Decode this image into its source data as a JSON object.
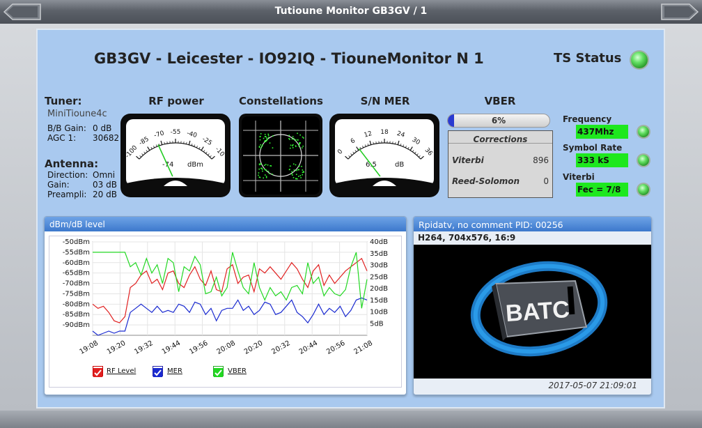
{
  "window": {
    "title": "Tutioune Monitor GB3GV / 1"
  },
  "header": {
    "station_title": "GB3GV - Leicester - IO92IQ - TiouneMonitor N 1",
    "ts_status_label": "TS Status"
  },
  "tuner": {
    "heading": "Tuner:",
    "model": "MiniTioune4c",
    "bb_gain_label": "B/B Gain:",
    "bb_gain_value": "0 dB",
    "agc_label": "AGC 1:",
    "agc_value": "30682 U"
  },
  "antenna": {
    "heading": "Antenna:",
    "direction_label": "Direction:",
    "direction_value": "Omni",
    "gain_label": "Gain:",
    "gain_value": "03 dB",
    "preampli_label": "Preampli:",
    "preampli_value": "20 dB"
  },
  "rf_power": {
    "title": "RF power",
    "reading": "-74",
    "unit": "dBm",
    "scale": [
      "-100",
      "-85",
      "-70",
      "-55",
      "-40",
      "-25",
      "-10"
    ],
    "min": -100,
    "max": -10,
    "value": -74
  },
  "constellations": {
    "title": "Constellations"
  },
  "mer": {
    "title": "S/N MER",
    "reading": "6.5",
    "unit": "dB",
    "scale": [
      "0",
      "6",
      "12",
      "18",
      "24",
      "30",
      "36"
    ],
    "min": 0,
    "max": 36,
    "value": 6.5
  },
  "vber": {
    "title": "VBER",
    "percent_text": "6%",
    "percent": 6,
    "corrections_title": "Corrections",
    "viterbi_label": "Viterbi",
    "viterbi_value": "896",
    "rs_label": "Reed-Solomon",
    "rs_value": "0"
  },
  "status": {
    "frequency_label": "Frequency",
    "frequency_value": "437Mhz",
    "symbol_rate_label": "Symbol Rate",
    "symbol_rate_value": "333 kS",
    "viterbi_label": "Viterbi",
    "viterbi_value": "Fec = 7/8"
  },
  "level_chart": {
    "header": "dBm/dB level",
    "legend": [
      "RF Level",
      "MER",
      "VBER"
    ]
  },
  "chart_data": {
    "type": "line",
    "title": "dBm/dB level",
    "x": [
      "19:08",
      "19:20",
      "19:32",
      "19:44",
      "19:56",
      "20:08",
      "20:20",
      "20:32",
      "20:44",
      "20:56",
      "21:08"
    ],
    "y_left_ticks": [
      "-50dBm",
      "-55dBm",
      "-60dBm",
      "-65dBm",
      "-70dBm",
      "-75dBm",
      "-80dBm",
      "-85dBm",
      "-90dBm"
    ],
    "y_right_ticks": [
      "40dB",
      "35dB",
      "30dB",
      "25dB",
      "20dB",
      "15dB",
      "10dB",
      "5dB"
    ],
    "ylim_left": [
      -95,
      -50
    ],
    "ylim_right": [
      0,
      40
    ],
    "grid": true,
    "series": [
      {
        "name": "RF Level",
        "color": "#e02020",
        "axis": "left",
        "values": [
          -80,
          -82,
          -81,
          -84,
          -88,
          -89,
          -86,
          -72,
          -70,
          -66,
          -64,
          -70,
          -68,
          -73,
          -65,
          -64,
          -70,
          -72,
          -66,
          -62,
          -68,
          -71,
          -64,
          -73,
          -74,
          -63,
          -61,
          -70,
          -67,
          -66,
          -74,
          -63,
          -65,
          -62,
          -65,
          -68,
          -64,
          -60,
          -63,
          -68,
          -72,
          -64,
          -61,
          -71,
          -66,
          -70,
          -67,
          -64,
          -62,
          -60,
          -58,
          -64
        ]
      },
      {
        "name": "MER",
        "color": "#1a2ad0",
        "axis": "left",
        "values": [
          -93,
          -95,
          -94,
          -93,
          -94,
          -93,
          -93,
          -84,
          -82,
          -80,
          -82,
          -84,
          -81,
          -84,
          -83,
          -84,
          -80,
          -81,
          -84,
          -79,
          -80,
          -85,
          -82,
          -88,
          -83,
          -82,
          -82,
          -78,
          -83,
          -81,
          -85,
          -83,
          -79,
          -80,
          -85,
          -84,
          -81,
          -78,
          -84,
          -86,
          -89,
          -85,
          -80,
          -85,
          -82,
          -84,
          -81,
          -86,
          -83,
          -78,
          -77,
          -78
        ]
      },
      {
        "name": "VBER",
        "color": "#22d822",
        "axis": "left",
        "values": [
          -55,
          -55,
          -55,
          -55,
          -55,
          -55,
          -55,
          -62,
          -60,
          -66,
          -58,
          -65,
          -61,
          -70,
          -58,
          -60,
          -74,
          -62,
          -64,
          -57,
          -61,
          -75,
          -74,
          -67,
          -76,
          -72,
          -55,
          -64,
          -72,
          -75,
          -60,
          -72,
          -78,
          -72,
          -76,
          -74,
          -78,
          -72,
          -71,
          -75,
          -60,
          -70,
          -67,
          -76,
          -72,
          -75,
          -76,
          -73,
          -62,
          -55,
          -82,
          -68
        ]
      }
    ]
  },
  "video": {
    "header": "Rpidatv, no comment PID: 00256",
    "format": "H264, 704x576, 16:9",
    "logo_text": "BATC",
    "timestamp": "2017-05-07 21:09:01"
  }
}
